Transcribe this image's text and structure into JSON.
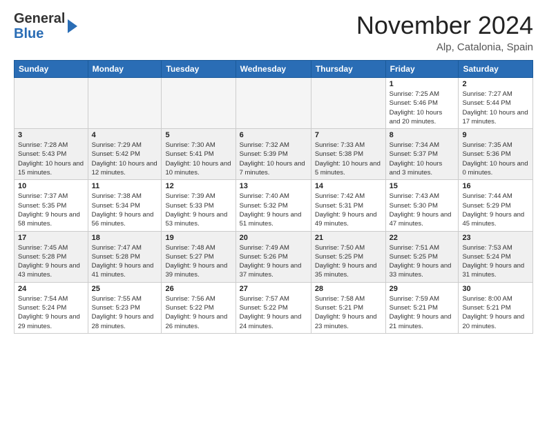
{
  "logo": {
    "line1": "General",
    "line2": "Blue"
  },
  "title": "November 2024",
  "location": "Alp, Catalonia, Spain",
  "headers": [
    "Sunday",
    "Monday",
    "Tuesday",
    "Wednesday",
    "Thursday",
    "Friday",
    "Saturday"
  ],
  "weeks": [
    [
      {
        "day": "",
        "empty": true
      },
      {
        "day": "",
        "empty": true
      },
      {
        "day": "",
        "empty": true
      },
      {
        "day": "",
        "empty": true
      },
      {
        "day": "",
        "empty": true
      },
      {
        "day": "1",
        "sunrise": "Sunrise: 7:25 AM",
        "sunset": "Sunset: 5:46 PM",
        "daylight": "Daylight: 10 hours and 20 minutes."
      },
      {
        "day": "2",
        "sunrise": "Sunrise: 7:27 AM",
        "sunset": "Sunset: 5:44 PM",
        "daylight": "Daylight: 10 hours and 17 minutes."
      }
    ],
    [
      {
        "day": "3",
        "sunrise": "Sunrise: 7:28 AM",
        "sunset": "Sunset: 5:43 PM",
        "daylight": "Daylight: 10 hours and 15 minutes."
      },
      {
        "day": "4",
        "sunrise": "Sunrise: 7:29 AM",
        "sunset": "Sunset: 5:42 PM",
        "daylight": "Daylight: 10 hours and 12 minutes."
      },
      {
        "day": "5",
        "sunrise": "Sunrise: 7:30 AM",
        "sunset": "Sunset: 5:41 PM",
        "daylight": "Daylight: 10 hours and 10 minutes."
      },
      {
        "day": "6",
        "sunrise": "Sunrise: 7:32 AM",
        "sunset": "Sunset: 5:39 PM",
        "daylight": "Daylight: 10 hours and 7 minutes."
      },
      {
        "day": "7",
        "sunrise": "Sunrise: 7:33 AM",
        "sunset": "Sunset: 5:38 PM",
        "daylight": "Daylight: 10 hours and 5 minutes."
      },
      {
        "day": "8",
        "sunrise": "Sunrise: 7:34 AM",
        "sunset": "Sunset: 5:37 PM",
        "daylight": "Daylight: 10 hours and 3 minutes."
      },
      {
        "day": "9",
        "sunrise": "Sunrise: 7:35 AM",
        "sunset": "Sunset: 5:36 PM",
        "daylight": "Daylight: 10 hours and 0 minutes."
      }
    ],
    [
      {
        "day": "10",
        "sunrise": "Sunrise: 7:37 AM",
        "sunset": "Sunset: 5:35 PM",
        "daylight": "Daylight: 9 hours and 58 minutes."
      },
      {
        "day": "11",
        "sunrise": "Sunrise: 7:38 AM",
        "sunset": "Sunset: 5:34 PM",
        "daylight": "Daylight: 9 hours and 56 minutes."
      },
      {
        "day": "12",
        "sunrise": "Sunrise: 7:39 AM",
        "sunset": "Sunset: 5:33 PM",
        "daylight": "Daylight: 9 hours and 53 minutes."
      },
      {
        "day": "13",
        "sunrise": "Sunrise: 7:40 AM",
        "sunset": "Sunset: 5:32 PM",
        "daylight": "Daylight: 9 hours and 51 minutes."
      },
      {
        "day": "14",
        "sunrise": "Sunrise: 7:42 AM",
        "sunset": "Sunset: 5:31 PM",
        "daylight": "Daylight: 9 hours and 49 minutes."
      },
      {
        "day": "15",
        "sunrise": "Sunrise: 7:43 AM",
        "sunset": "Sunset: 5:30 PM",
        "daylight": "Daylight: 9 hours and 47 minutes."
      },
      {
        "day": "16",
        "sunrise": "Sunrise: 7:44 AM",
        "sunset": "Sunset: 5:29 PM",
        "daylight": "Daylight: 9 hours and 45 minutes."
      }
    ],
    [
      {
        "day": "17",
        "sunrise": "Sunrise: 7:45 AM",
        "sunset": "Sunset: 5:28 PM",
        "daylight": "Daylight: 9 hours and 43 minutes."
      },
      {
        "day": "18",
        "sunrise": "Sunrise: 7:47 AM",
        "sunset": "Sunset: 5:28 PM",
        "daylight": "Daylight: 9 hours and 41 minutes."
      },
      {
        "day": "19",
        "sunrise": "Sunrise: 7:48 AM",
        "sunset": "Sunset: 5:27 PM",
        "daylight": "Daylight: 9 hours and 39 minutes."
      },
      {
        "day": "20",
        "sunrise": "Sunrise: 7:49 AM",
        "sunset": "Sunset: 5:26 PM",
        "daylight": "Daylight: 9 hours and 37 minutes."
      },
      {
        "day": "21",
        "sunrise": "Sunrise: 7:50 AM",
        "sunset": "Sunset: 5:25 PM",
        "daylight": "Daylight: 9 hours and 35 minutes."
      },
      {
        "day": "22",
        "sunrise": "Sunrise: 7:51 AM",
        "sunset": "Sunset: 5:25 PM",
        "daylight": "Daylight: 9 hours and 33 minutes."
      },
      {
        "day": "23",
        "sunrise": "Sunrise: 7:53 AM",
        "sunset": "Sunset: 5:24 PM",
        "daylight": "Daylight: 9 hours and 31 minutes."
      }
    ],
    [
      {
        "day": "24",
        "sunrise": "Sunrise: 7:54 AM",
        "sunset": "Sunset: 5:24 PM",
        "daylight": "Daylight: 9 hours and 29 minutes."
      },
      {
        "day": "25",
        "sunrise": "Sunrise: 7:55 AM",
        "sunset": "Sunset: 5:23 PM",
        "daylight": "Daylight: 9 hours and 28 minutes."
      },
      {
        "day": "26",
        "sunrise": "Sunrise: 7:56 AM",
        "sunset": "Sunset: 5:22 PM",
        "daylight": "Daylight: 9 hours and 26 minutes."
      },
      {
        "day": "27",
        "sunrise": "Sunrise: 7:57 AM",
        "sunset": "Sunset: 5:22 PM",
        "daylight": "Daylight: 9 hours and 24 minutes."
      },
      {
        "day": "28",
        "sunrise": "Sunrise: 7:58 AM",
        "sunset": "Sunset: 5:21 PM",
        "daylight": "Daylight: 9 hours and 23 minutes."
      },
      {
        "day": "29",
        "sunrise": "Sunrise: 7:59 AM",
        "sunset": "Sunset: 5:21 PM",
        "daylight": "Daylight: 9 hours and 21 minutes."
      },
      {
        "day": "30",
        "sunrise": "Sunrise: 8:00 AM",
        "sunset": "Sunset: 5:21 PM",
        "daylight": "Daylight: 9 hours and 20 minutes."
      }
    ]
  ]
}
